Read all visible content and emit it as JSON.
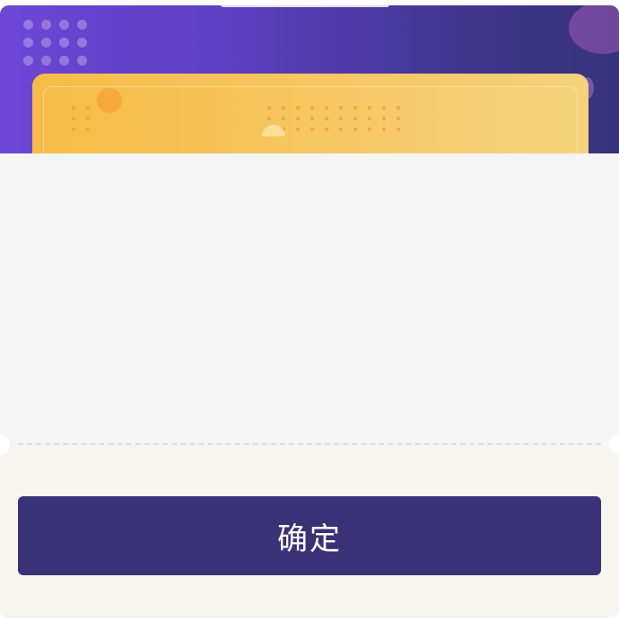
{
  "dialog": {
    "confirm_label": "确定"
  },
  "colors": {
    "header_start": "#6d47d6",
    "header_end": "#37337a",
    "card": "#f6c660",
    "button": "#3a3276",
    "content_bg": "#f5f5f5",
    "footer_bg": "#f7f5ef"
  }
}
